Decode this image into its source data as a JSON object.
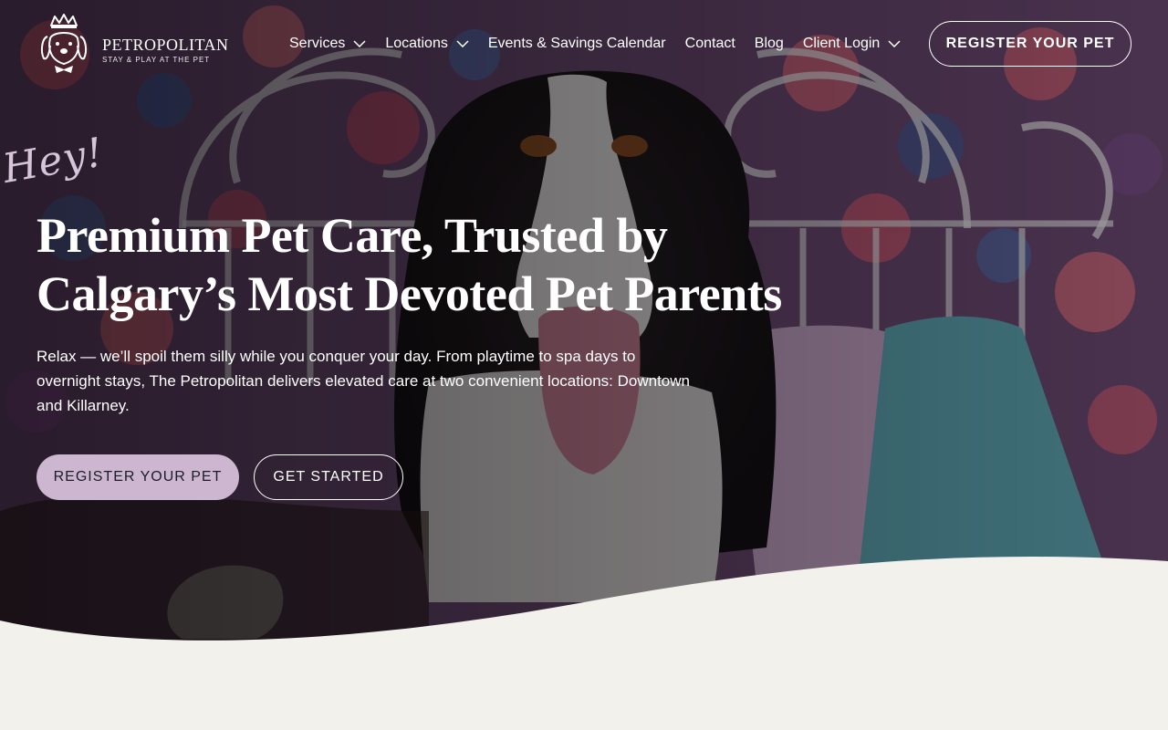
{
  "brand": {
    "name": "PETROPOLITAN",
    "tagline": "STAY & PLAY AT THE PET"
  },
  "nav": {
    "services": "Services",
    "locations": "Locations",
    "events": "Events & Savings Calendar",
    "contact": "Contact",
    "blog": "Blog",
    "client_login": "Client Login"
  },
  "header": {
    "register_label": "REGISTER YOUR PET"
  },
  "hero": {
    "hey": "Hey!",
    "headline_line1": "Premium Pet Care, Trusted by",
    "headline_line2": "Calgary’s Most Devoted Pet Parents",
    "lede": "Relax — we’ll spoil them silly while you conquer your day. From playtime to spa days to overnight stays, The Petropolitan delivers elevated care at two convenient locations: Downtown and Killarney.",
    "primary_cta": "REGISTER YOUR PET",
    "secondary_cta": "GET STARTED"
  },
  "colors": {
    "accent_lilac": "#cdb6cf",
    "page_background": "#f3f1ec",
    "hey_text": "#d6c5da"
  }
}
